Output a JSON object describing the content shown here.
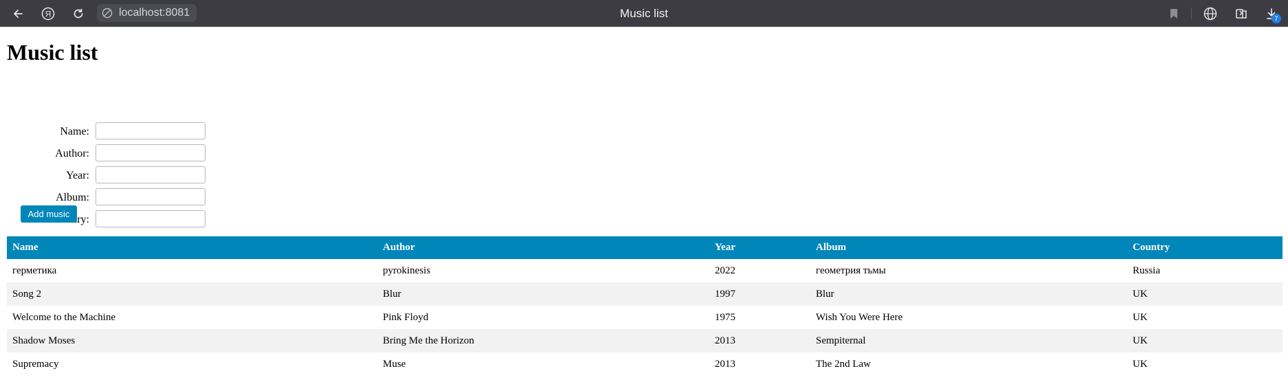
{
  "browser": {
    "url": "localhost:8081",
    "tab_title": "Music list",
    "downloads_badge": "7"
  },
  "page": {
    "title": "Music list",
    "form": {
      "fields": [
        {
          "label": "Name:",
          "value": ""
        },
        {
          "label": "Author:",
          "value": ""
        },
        {
          "label": "Year:",
          "value": ""
        },
        {
          "label": "Album:",
          "value": ""
        },
        {
          "label": "Country:",
          "value": ""
        }
      ],
      "submit_label": "Add music"
    },
    "table": {
      "headers": [
        "Name",
        "Author",
        "Year",
        "Album",
        "Country"
      ],
      "rows": [
        [
          "герметика",
          "pyrokinesis",
          "2022",
          "геометрия тьмы",
          "Russia"
        ],
        [
          "Song 2",
          "Blur",
          "1997",
          "Blur",
          "UK"
        ],
        [
          "Welcome to the Machine",
          "Pink Floyd",
          "1975",
          "Wish You Were Here",
          "UK"
        ],
        [
          "Shadow Moses",
          "Bring Me the Horizon",
          "2013",
          "Sempiternal",
          "UK"
        ],
        [
          "Supremacy",
          "Muse",
          "2013",
          "The 2nd Law",
          "UK"
        ]
      ]
    }
  },
  "colors": {
    "accent": "#0086b8",
    "chrome_bg": "#3c3c42",
    "row_stripe": "#f2f2f2"
  }
}
